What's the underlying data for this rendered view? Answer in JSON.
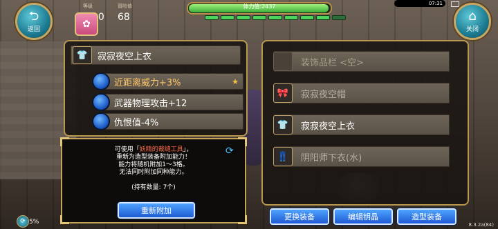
{
  "topbar": {
    "back_label": "返回",
    "close_label": "关闭",
    "level_label": "等级",
    "level_value": "230",
    "explore_label": "冒险值",
    "explore_value": "68",
    "hp_text": "体力值:2437",
    "hp_fraction": 0.98,
    "energy_segments": 9,
    "energy_filled": 8,
    "clock": "07:31"
  },
  "left_panel": {
    "item_name": "寂寂夜空上衣",
    "item_icon": "shirt-icon",
    "attributes": [
      {
        "text": "近距离威力+3%",
        "starred": true
      },
      {
        "text": "武器物理攻击+12",
        "starred": false
      },
      {
        "text": "仇恨值-4%",
        "starred": false
      }
    ]
  },
  "info_panel": {
    "line1_prefix": "可使用「",
    "line1_item": "妖精的裁缝工具",
    "line1_suffix": "」，",
    "line2": "重新为造型装备附加能力！",
    "line3": "能力将随机附加1～3格。",
    "line4": "无法同时附加同种能力。",
    "held": "(持有数量: 7个)",
    "reattach_label": "重新附加"
  },
  "right_panel": {
    "slots": [
      {
        "label": "装饰品栏 <空>",
        "icon": "empty-slot-icon"
      },
      {
        "label": "寂寂夜空帽",
        "icon": "hat-icon"
      },
      {
        "label": "寂寂夜空上衣",
        "icon": "shirt-icon"
      },
      {
        "label": "阴阳师下衣(水)",
        "icon": "pants-icon"
      }
    ]
  },
  "bottom_buttons": {
    "swap": "更换装备",
    "edit": "编辑钥晶",
    "style": "造型装备"
  },
  "status": {
    "network_pct": "5%",
    "version": "8.3.2a(84)"
  },
  "colors": {
    "accent_gold": "#c9a762",
    "highlight_orange": "#ffc86a",
    "button_blue": "#1e5ad2",
    "hp_green": "#4fd15e"
  }
}
